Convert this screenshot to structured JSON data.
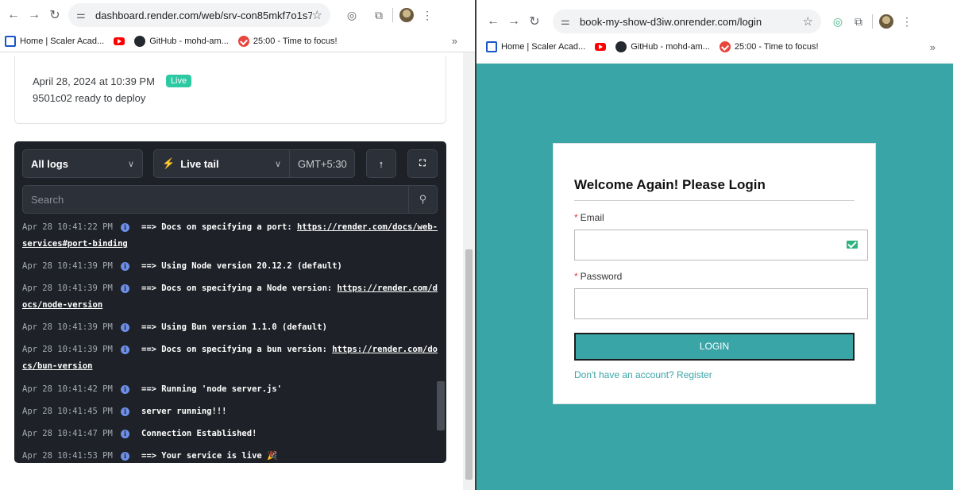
{
  "left_browser": {
    "url": "dashboard.render.com/web/srv-con85mkf7o1s7...",
    "bookmarks": [
      "Home | Scaler Acad...",
      "GitHub - mohd-am...",
      "25:00 - Time to focus!"
    ],
    "more": "»"
  },
  "deploy": {
    "date": "April 28, 2024 at 10:39 PM",
    "badge": "Live",
    "status": "9501c02  ready to deploy"
  },
  "logs": {
    "filter": "All logs",
    "mode": "Live tail",
    "timezone": "GMT+5:30",
    "search_placeholder": "Search",
    "info_glyph": "i",
    "lines": [
      {
        "ts": "Apr 28 10:41:22 PM",
        "msg": "==> Docs on specifying a port: ",
        "link": "https://render.com/docs/web-",
        "wrap": "services#port-binding"
      },
      {
        "ts": "Apr 28 10:41:39 PM",
        "msg": "==> Using Node version 20.12.2 (default)"
      },
      {
        "ts": "Apr 28 10:41:39 PM",
        "msg": "==> Docs on specifying a Node version: ",
        "link": "https://render.com/d",
        "wrap": "ocs/node-version"
      },
      {
        "ts": "Apr 28 10:41:39 PM",
        "msg": "==> Using Bun version 1.1.0 (default)"
      },
      {
        "ts": "Apr 28 10:41:39 PM",
        "msg": "==> Docs on specifying a bun version: ",
        "link": "https://render.com/do",
        "wrap": "cs/bun-version"
      },
      {
        "ts": "Apr 28 10:41:42 PM",
        "msg": "==> Running 'node server.js'"
      },
      {
        "ts": "Apr 28 10:41:45 PM",
        "msg": "server running!!!"
      },
      {
        "ts": "Apr 28 10:41:47 PM",
        "msg": "Connection Established!"
      },
      {
        "ts": "Apr 28 10:41:53 PM",
        "msg": "==> Your service is live 🎉"
      }
    ]
  },
  "right_browser": {
    "url": "book-my-show-d3iw.onrender.com/login",
    "bookmarks": [
      "Home | Scaler Acad...",
      "GitHub - mohd-am...",
      "25:00 - Time to focus!"
    ],
    "more": "»"
  },
  "login": {
    "title": "Welcome Again! Please Login",
    "email_label": "Email",
    "password_label": "Password",
    "required_mark": "*",
    "button": "LOGIN",
    "register": "Don't have an account? Register"
  },
  "colors": {
    "teal": "#3aa5a6",
    "live_badge": "#2cc9a3",
    "logs_bg": "#1e2127"
  }
}
